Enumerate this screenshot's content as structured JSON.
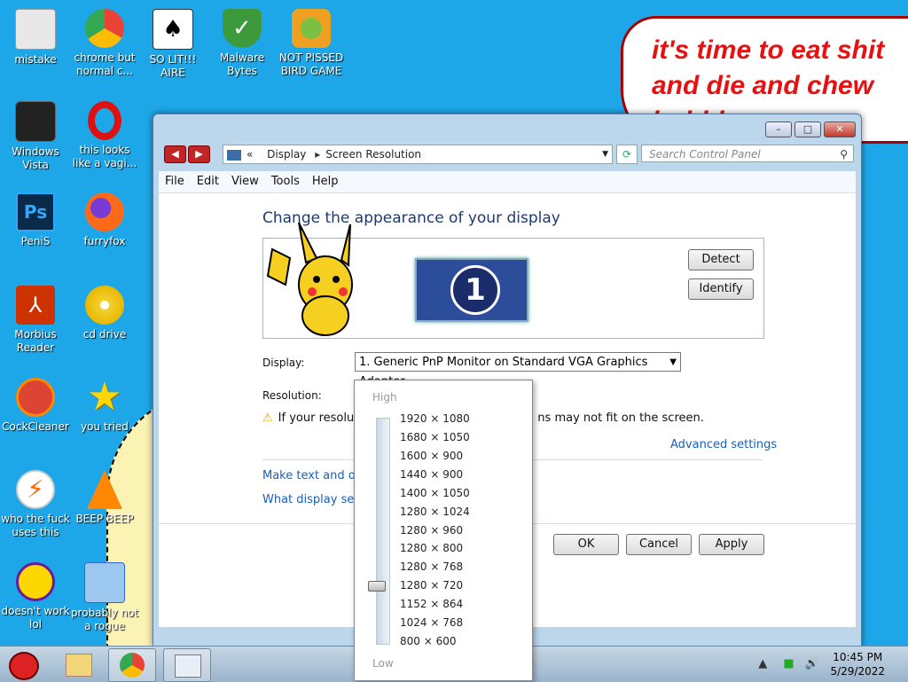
{
  "desktop": {
    "icons": [
      {
        "label": "mistake",
        "icon": "computer-icon"
      },
      {
        "label": "chrome but normal c...",
        "icon": "chrome-icon"
      },
      {
        "label": "SO LIT!!! AIRE",
        "icon": "solitaire-icon"
      },
      {
        "label": "Malware Bytes",
        "icon": "shield-icon"
      },
      {
        "label": "NOT PISSED BIRD GAME",
        "icon": "angry-bird-icon"
      },
      {
        "label": "Windows Vista",
        "icon": "trash-icon"
      },
      {
        "label": "this looks like a vagi...",
        "icon": "opera-icon"
      },
      {
        "label": "PeniS",
        "icon": "photoshop-icon"
      },
      {
        "label": "furryfox",
        "icon": "firefox-icon"
      },
      {
        "label": "Morbius Reader",
        "icon": "pdf-icon"
      },
      {
        "label": "cd drive",
        "icon": "cd-icon"
      },
      {
        "label": "CockCleaner",
        "icon": "ccleaner-icon"
      },
      {
        "label": "you tried",
        "icon": "star-icon"
      },
      {
        "label": "who the fuck uses this",
        "icon": "lightning-icon"
      },
      {
        "label": "BEEP BEEP",
        "icon": "vlc-icon"
      },
      {
        "label": "doesn't work lol",
        "icon": "yahoo-icon"
      },
      {
        "label": "probably not a rogue",
        "icon": "setup-icon"
      }
    ],
    "speech_lines": [
      "it's time to eat shit",
      "and die and chew",
      "bubble gum"
    ]
  },
  "window": {
    "breadcrumb": [
      "Display",
      "Screen Resolution"
    ],
    "search_placeholder": "Search Control Panel",
    "menu": [
      "File",
      "Edit",
      "View",
      "Tools",
      "Help"
    ],
    "heading": "Change the appearance of your display",
    "monitor_number": "1",
    "detect_label": "Detect",
    "identify_label": "Identify",
    "display_label": "Display:",
    "display_value": "1. Generic PnP Monitor on Standard VGA Graphics Adapter",
    "resolution_label": "Resolution:",
    "warning_left": "If your resolut",
    "warning_right": "ns may not fit on the screen.",
    "advanced_link": "Advanced settings",
    "link_text_size": "Make text and oth",
    "link_display_settings": "What display setti",
    "ok_label": "OK",
    "cancel_label": "Cancel",
    "apply_label": "Apply"
  },
  "resolution_dropdown": {
    "high_label": "High",
    "low_label": "Low",
    "options": [
      "1920 × 1080",
      "1680 × 1050",
      "1600 × 900",
      "1440 × 900",
      "1400 × 1050",
      "1280 × 1024",
      "1280 × 960",
      "1280 × 800",
      "1280 × 768",
      "1280 × 720",
      "1152 × 864",
      "1024 × 768",
      "800 × 600"
    ],
    "selected": "1280 × 720"
  },
  "taskbar": {
    "time": "10:45 PM",
    "date": "5/29/2022"
  },
  "colors": {
    "desktop_bg": "#1ea7e8",
    "link": "#1a5fb4",
    "speech_text": "#e81010"
  }
}
